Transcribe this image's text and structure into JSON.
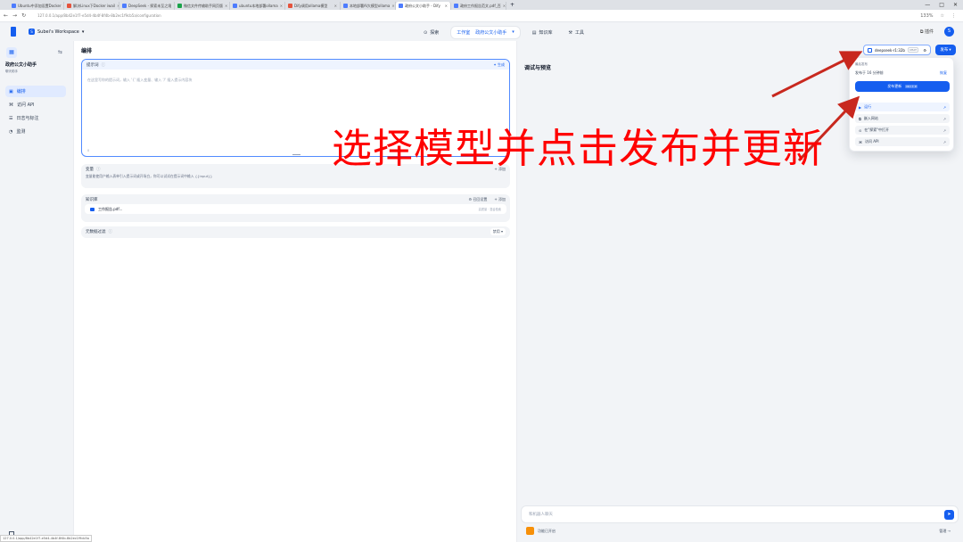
{
  "browser": {
    "tabs": [
      {
        "title": "Ubuntu中添加设置Docker",
        "fav": "b"
      },
      {
        "title": "解决Linux下Docker iwail",
        "fav": "r"
      },
      {
        "title": "DeepSeek - 探索未至之境",
        "fav": "b"
      },
      {
        "title": "微信文件传输助手网页版",
        "fav": "g"
      },
      {
        "title": "ubuntu本地部署ollama",
        "fav": "b"
      },
      {
        "title": "Dify调用ollama模型",
        "fav": "r"
      },
      {
        "title": "本地部署AI大模型ollama",
        "fav": "b"
      },
      {
        "title": "政府公文小助手 - Dify",
        "fav": "b",
        "active": true
      },
      {
        "title": "政府工作报告范文.pdf_百",
        "fav": "b"
      }
    ],
    "new_tab": "+",
    "url": "127.0.0.1/app/8b42e1f7-e5d4-4b4f-8f4b-8b2ec1f9cb5a/configuration",
    "zoom": "133%",
    "status_url": "127.0.0.1/app/8b42e1f7-e5d4-4b4f-8f4b-8b2ec1f9cb5a"
  },
  "appbar": {
    "workspace": "Subei's Workspace",
    "nav": {
      "explore": "探索",
      "studio": "工作室",
      "app": "政府公文小助手",
      "knowledge": "知识库",
      "tools": "工具"
    },
    "plugins": "插件",
    "avatar": "S"
  },
  "sidebar": {
    "app_name": "政府公文小助手",
    "app_type": "聊天助手",
    "items": [
      {
        "label": "编排",
        "icon": "layers-icon",
        "active": true
      },
      {
        "label": "访问 API",
        "icon": "terminal-icon"
      },
      {
        "label": "日志与标注",
        "icon": "file-icon"
      },
      {
        "label": "监测",
        "icon": "chart-icon"
      }
    ]
  },
  "editor": {
    "title": "编排",
    "prompt": {
      "label": "提示词",
      "generate": "生成",
      "placeholder": "在这里写你的提示词，输入 '{' 插入变量、输入 '/' 插入提示内容块",
      "count": "0"
    },
    "variables": {
      "label": "变量",
      "add": "添加",
      "desc": "变量能使用户输入表单引入提示词或开场白，你可以试试在提示词中输入 {{input}}"
    },
    "knowledge": {
      "label": "知识库",
      "recall": "召回设置",
      "add": "添加",
      "items": [
        {
          "name": "工作报告.pdf...",
          "meta": "高质量 · 混合检索"
        }
      ]
    },
    "metadata": {
      "label": "元数据过滤",
      "value": "禁用"
    }
  },
  "debug": {
    "title": "调试与预览",
    "chat_placeholder": "和机器人聊天",
    "opener": "功能已开启",
    "manage": "管理"
  },
  "model_selector": {
    "name": "deepseek-r1:32b",
    "tag": "CHAT"
  },
  "publish": {
    "button": "发布",
    "last_published": "最后发布",
    "time": "发布于 16 分钟前",
    "restore": "恢复",
    "update": "发布更新",
    "shortcut": "Ctrl ⇧ P",
    "items": [
      {
        "label": "运行",
        "icon": "play-icon",
        "highlight": true
      },
      {
        "label": "嵌入网站",
        "icon": "embed-icon"
      },
      {
        "label": "在\"探索\"中打开",
        "icon": "compass-icon"
      },
      {
        "label": "访问 API",
        "icon": "terminal-icon"
      }
    ]
  },
  "annotation": "选择模型并点击发布并更新"
}
